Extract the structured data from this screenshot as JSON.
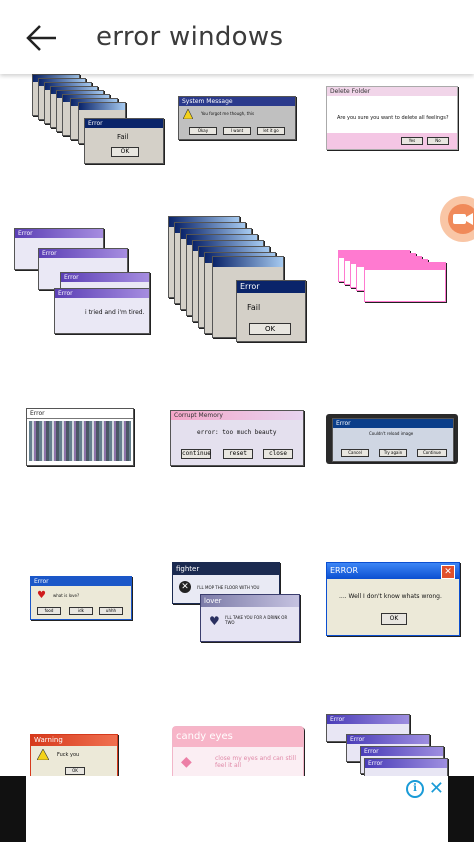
{
  "header": {
    "title": "error windows"
  },
  "grid": {
    "r1c1": {
      "title": "Error",
      "text": "Fail",
      "button": "OK"
    },
    "r1c2": {
      "title": "System Message",
      "text": "You forgot me though, this",
      "buttons": [
        "Okay",
        "I want",
        "let it go"
      ]
    },
    "r1c3": {
      "title": "Delete Folder",
      "text": "Are you sure you want to delete all feelings?",
      "buttons": [
        "Yes",
        "No"
      ]
    },
    "r2c1": {
      "titles": [
        "Error",
        "Error",
        "Error",
        "Error"
      ],
      "text": "i tried and i'm tired."
    },
    "r2c2": {
      "title": "Error",
      "text": "Fail",
      "button": "OK"
    },
    "r3c1": {
      "title": "Error"
    },
    "r3c2": {
      "title": "Corrupt Memory",
      "text": "error: too much beauty",
      "buttons": [
        "continue",
        "reset",
        "close"
      ]
    },
    "r3c3": {
      "title": "Error",
      "text": "Couldn't reload image",
      "buttons": [
        "Cancel",
        "Try again",
        "Continue"
      ]
    },
    "r4c1": {
      "title": "Error",
      "text": "what is love?",
      "buttons": [
        "food",
        "idk",
        "uhhh"
      ]
    },
    "r4c2": {
      "fighter_title": "fighter",
      "fighter_text": "I'LL MOP THE FLOOR WITH YOU",
      "lover_title": "lover",
      "lover_text": "I'LL TAKE YOU FOR A DRINK OR TWO"
    },
    "r4c3": {
      "title": "ERROR",
      "text": ".... Well I don't know whats wrong.",
      "button": "OK"
    },
    "r5c1": {
      "title": "Warning",
      "text": "Fuck you",
      "button": "OK"
    },
    "r5c2": {
      "title": "candy eyes",
      "text": "close my eyes and can still feel it all"
    },
    "r5c3": {
      "titles": [
        "Error",
        "Error",
        "Error",
        "Error"
      ]
    }
  },
  "colors": {
    "accent_orange": "#f08a5a",
    "ad_blue": "#1a9bd7"
  }
}
